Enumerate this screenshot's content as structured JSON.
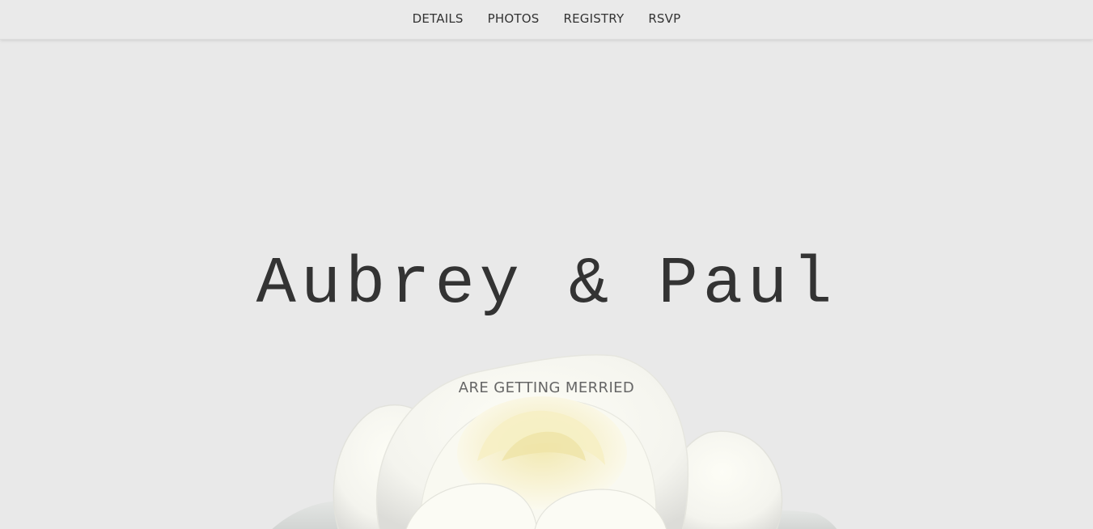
{
  "nav": {
    "items": [
      {
        "label": "DETAILS"
      },
      {
        "label": "PHOTOS"
      },
      {
        "label": "REGISTRY"
      },
      {
        "label": "RSVP"
      }
    ]
  },
  "hero": {
    "title": "Aubrey & Paul",
    "subtitle": "ARE GETTING MERRIED"
  },
  "colors": {
    "background": "#e9e9e9",
    "text_dark": "#333333",
    "text_muted": "#666666",
    "rose_petal": "#fbfaf1",
    "rose_center": "#f5eec0"
  }
}
